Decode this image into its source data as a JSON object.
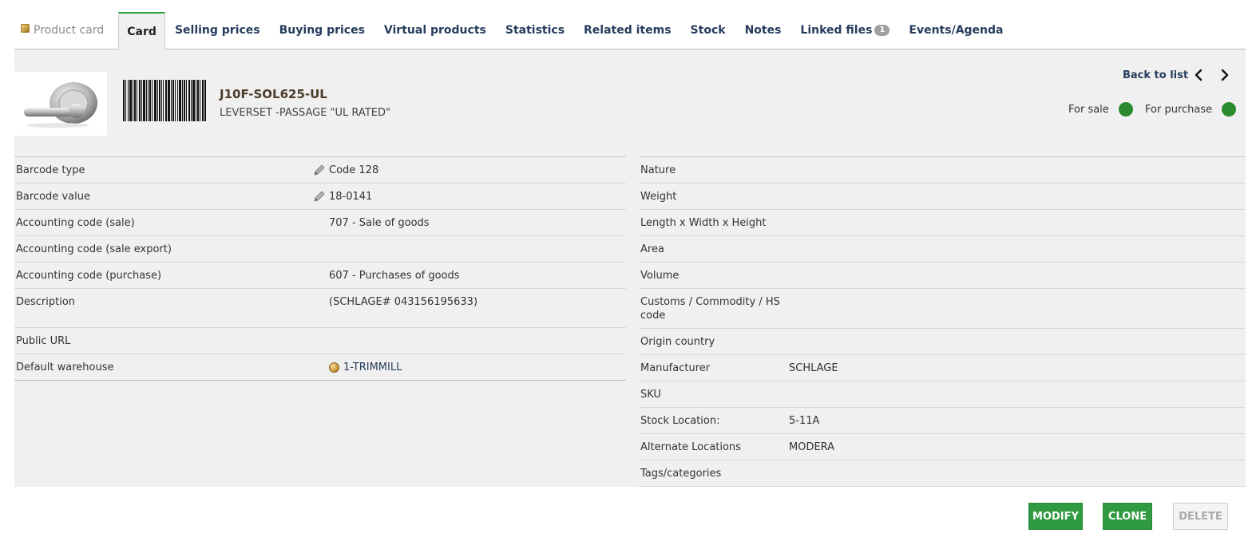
{
  "tabs": {
    "title": "Product card",
    "items": [
      {
        "label": "Card"
      },
      {
        "label": "Selling prices"
      },
      {
        "label": "Buying prices"
      },
      {
        "label": "Virtual products"
      },
      {
        "label": "Statistics"
      },
      {
        "label": "Related items"
      },
      {
        "label": "Stock"
      },
      {
        "label": "Notes"
      },
      {
        "label": "Linked files",
        "badge": "1"
      },
      {
        "label": "Events/Agenda"
      }
    ]
  },
  "header": {
    "ref": "J10F-SOL625-UL",
    "label": "LEVERSET -PASSAGE \"UL RATED\"",
    "back_link": "Back to list",
    "for_sale": "For sale",
    "for_purchase": "For purchase",
    "status_color": "#2a8a2e"
  },
  "left_fields": [
    {
      "label": "Barcode type",
      "value": "Code 128"
    },
    {
      "label": "Barcode value",
      "value": "18-0141"
    },
    {
      "label": "Accounting code (sale)",
      "value": "707 - Sale of goods"
    },
    {
      "label": "Accounting code (sale export)",
      "value": ""
    },
    {
      "label": "Accounting code (purchase)",
      "value": "607 - Purchases of goods"
    },
    {
      "label": "Description",
      "value": "(SCHLAGE# 043156195633)"
    },
    {
      "label": "Public URL",
      "value": ""
    },
    {
      "label": "Default warehouse",
      "value": "1-TRIMMILL"
    }
  ],
  "right_fields": [
    {
      "label": "Nature",
      "value": ""
    },
    {
      "label": "Weight",
      "value": ""
    },
    {
      "label": "Length x Width x Height",
      "value": ""
    },
    {
      "label": "Area",
      "value": ""
    },
    {
      "label": "Volume",
      "value": ""
    },
    {
      "label": "Customs / Commodity / HS code",
      "value": ""
    },
    {
      "label": "Origin country",
      "value": ""
    },
    {
      "label": "Manufacturer",
      "value": "SCHLAGE"
    },
    {
      "label": "SKU",
      "value": ""
    },
    {
      "label": "Stock Location:",
      "value": "5-11A"
    },
    {
      "label": "Alternate Locations",
      "value": "MODERA"
    },
    {
      "label": "Tags/categories",
      "value": ""
    }
  ],
  "buttons": {
    "modify": "MODIFY",
    "clone": "CLONE",
    "delete": "DELETE",
    "accent": "#2f9a40"
  }
}
